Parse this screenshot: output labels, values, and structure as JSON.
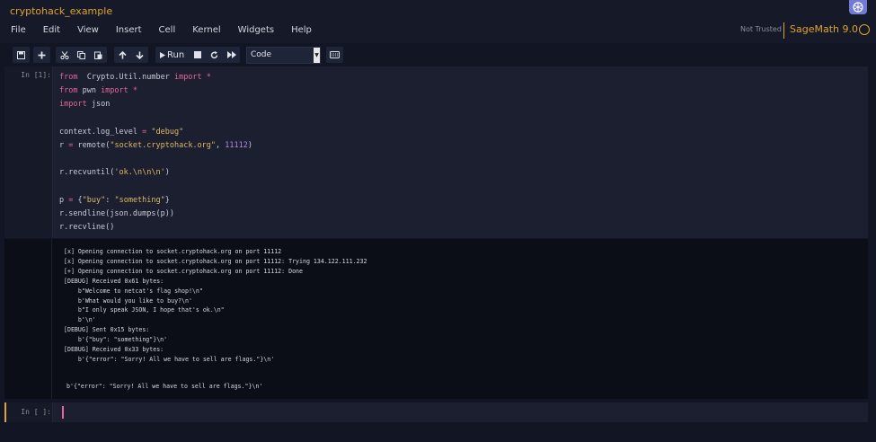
{
  "notebook": {
    "title": "cryptohack_example"
  },
  "menu": [
    "File",
    "Edit",
    "View",
    "Insert",
    "Cell",
    "Kernel",
    "Widgets",
    "Help"
  ],
  "status": {
    "trust": "Not Trusted",
    "kernel": "SageMath 9.0"
  },
  "toolbar": {
    "run_label": "Run",
    "cell_type": "Code"
  },
  "cells": [
    {
      "prompt": "In [1]:",
      "code": [
        [
          [
            "kw",
            "from"
          ],
          [
            "",
            "  Crypto.Util.number "
          ],
          [
            "kw",
            "import"
          ],
          [
            "kw",
            " *"
          ]
        ],
        [
          [
            "kw",
            "from"
          ],
          [
            "",
            " pwn "
          ],
          [
            "kw",
            "import"
          ],
          [
            "kw",
            " *"
          ]
        ],
        [
          [
            "kw",
            "import"
          ],
          [
            "",
            " json"
          ]
        ],
        [],
        [
          [
            "",
            "context.log_level "
          ],
          [
            "kw",
            "="
          ],
          [
            "",
            ""
          ],
          [
            "str",
            " \"debug\""
          ]
        ],
        [
          [
            "",
            "r "
          ],
          [
            "kw",
            "="
          ],
          [
            "",
            " remote("
          ],
          [
            "str",
            "\"socket.cryptohack.org\""
          ],
          [
            "",
            ", "
          ],
          [
            "num",
            "11112"
          ],
          [
            "",
            ")"
          ]
        ],
        [],
        [
          [
            "",
            "r.recvuntil("
          ],
          [
            "str",
            "'ok.\\n\\n\\n'"
          ],
          [
            "",
            ")"
          ]
        ],
        [],
        [
          [
            "",
            "p "
          ],
          [
            "kw",
            "="
          ],
          [
            "",
            " {"
          ],
          [
            "str",
            "\"buy\""
          ],
          [
            "",
            ": "
          ],
          [
            "str",
            "\"something\""
          ],
          [
            "",
            "}"
          ]
        ],
        [
          [
            "",
            "r.sendline(json.dumps(p))"
          ]
        ],
        [
          [
            "",
            "r.recvline()"
          ]
        ]
      ],
      "stderr": [
        "[x] Opening connection to socket.cryptohack.org on port 11112",
        "[x] Opening connection to socket.cryptohack.org on port 11112: Trying 134.122.111.232",
        "[+] Opening connection to socket.cryptohack.org on port 11112: Done",
        "[DEBUG] Received 0x61 bytes:",
        "    b\"Welcome to netcat's flag shop!\\n\"",
        "    b'What would you like to buy?\\n'",
        "    b\"I only speak JSON, I hope that's ok.\\n\"",
        "    b'\\n'",
        "[DEBUG] Sent 0x15 bytes:",
        "    b'{\"buy\": \"something\"}\\n'",
        "[DEBUG] Received 0x33 bytes:",
        "    b'{\"error\": \"Sorry! All we have to sell are flags.\"}\\n'"
      ],
      "stdout": "b'{\"error\": \"Sorry! All we have to sell are flags.\"}\\n'"
    },
    {
      "prompt": "In [ ]:"
    }
  ]
}
